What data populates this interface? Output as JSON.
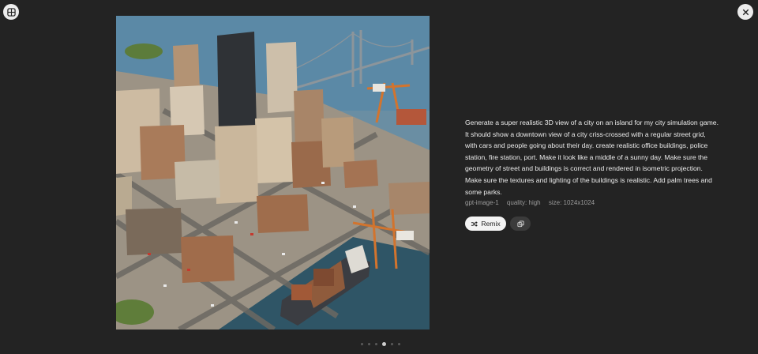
{
  "toolbar": {
    "grid_icon": "grid-icon",
    "close_icon": "close-icon"
  },
  "image": {
    "alt": "Isometric 3D city on an island with downtown grid, port cranes, cargo ship and suspension bridge"
  },
  "prompt": {
    "text": "Generate a super realistic 3D view of a city on an island for my city simulation game. It should show a downtown view of a city criss-crossed with a regular street grid, with cars and people going about their day. create realistic office buildings, police station, fire station, port. Make it look like a middle of a sunny day. Make sure the geometry of street and buildings is correct and rendered in isometric projection. Make sure the textures and lighting of the buildings is realistic. Add palm trees and some parks."
  },
  "meta": {
    "model": "gpt-image-1",
    "quality": "quality: high",
    "size": "size: 1024x1024"
  },
  "actions": {
    "remix_label": "Remix",
    "remix_icon": "shuffle-icon",
    "copy_icon": "copy-icon"
  },
  "pagination": {
    "count": 6,
    "active_index": 3
  },
  "colors": {
    "background": "#232323",
    "button_light": "#f3f3f3",
    "button_dark": "#3b3b3b"
  }
}
